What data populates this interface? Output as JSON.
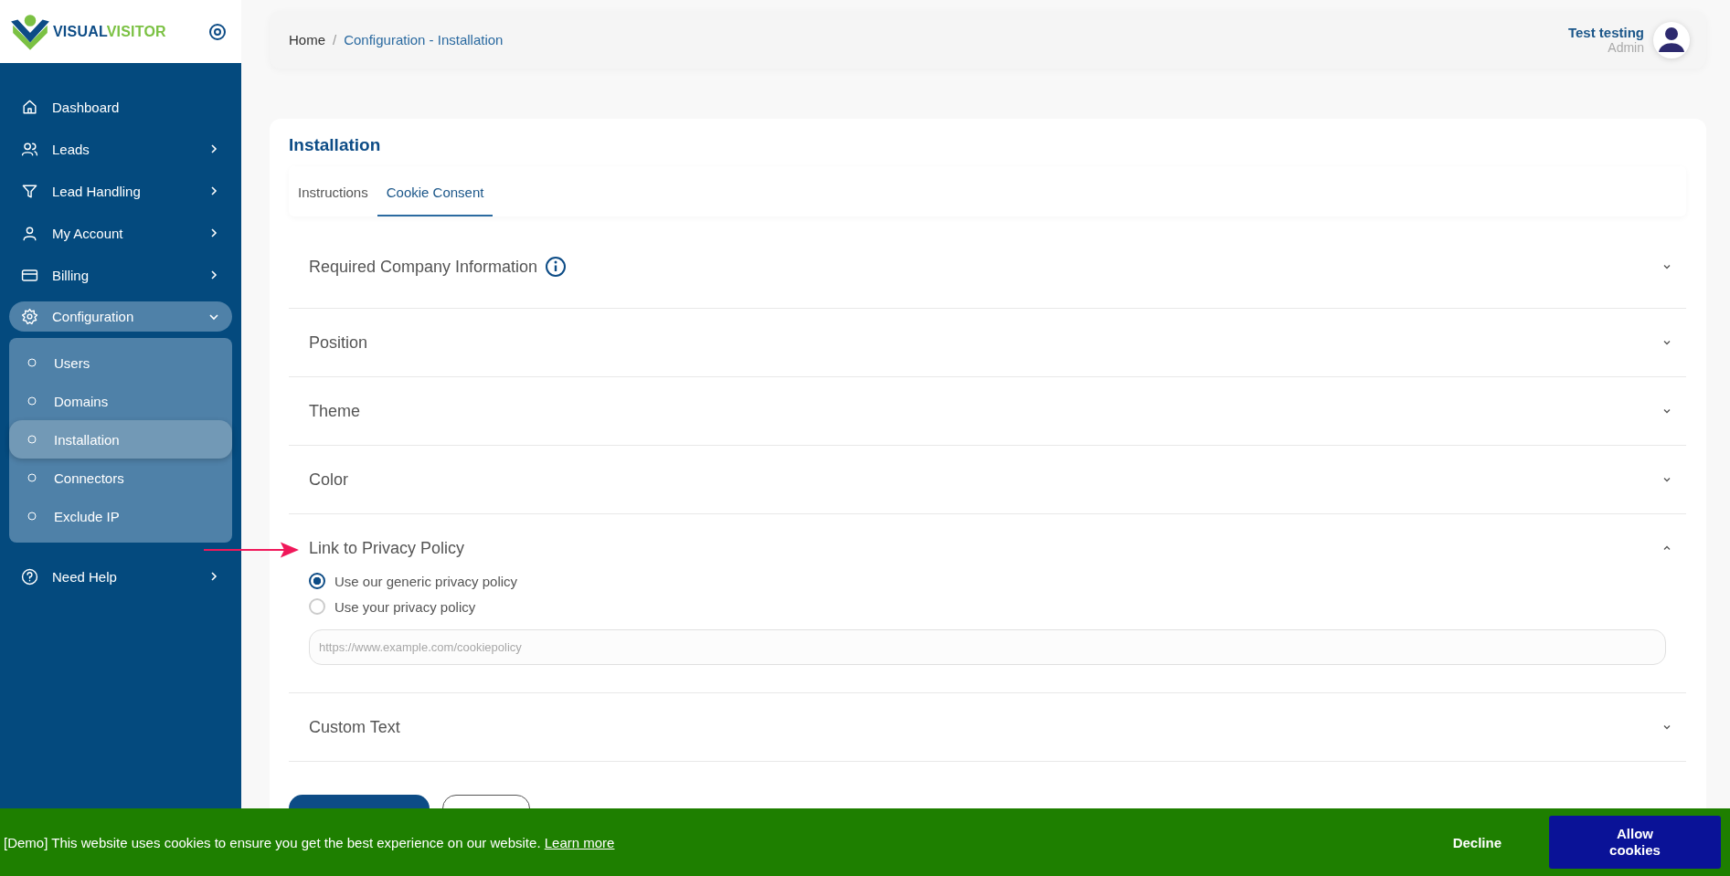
{
  "sidebar": {
    "logo": {
      "part_1": "VISUAL",
      "part_2": "VISITOR"
    },
    "items": [
      {
        "label": "Dashboard",
        "kind": "link"
      },
      {
        "label": "Leads",
        "kind": "group",
        "expanded": false
      },
      {
        "label": "Lead Handling",
        "kind": "group",
        "expanded": false
      },
      {
        "label": "My Account",
        "kind": "group",
        "expanded": false
      },
      {
        "label": "Billing",
        "kind": "group",
        "expanded": false
      },
      {
        "label": "Configuration",
        "kind": "group",
        "expanded": true,
        "children": [
          {
            "label": "Users",
            "selected": false
          },
          {
            "label": "Domains",
            "selected": false
          },
          {
            "label": "Installation",
            "selected": true
          },
          {
            "label": "Connectors",
            "selected": false
          },
          {
            "label": "Exclude IP",
            "selected": false
          }
        ]
      },
      {
        "label": "Need Help",
        "kind": "group",
        "expanded": false
      }
    ]
  },
  "breadcrumb": {
    "separator": "/",
    "items": [
      "Home",
      "Configuration - Installation"
    ]
  },
  "user": {
    "name": "Test testing",
    "role": "Admin"
  },
  "card": {
    "title": "Installation",
    "tabs": [
      {
        "label": "Instructions",
        "selected": false
      },
      {
        "label": "Cookie Consent",
        "selected": true
      }
    ],
    "sections": [
      {
        "title": "Required Company Information",
        "info": true,
        "expanded": false,
        "annotated": false
      },
      {
        "title": "Position",
        "info": false,
        "expanded": false,
        "annotated": false
      },
      {
        "title": "Theme",
        "info": false,
        "expanded": false,
        "annotated": false
      },
      {
        "title": "Color",
        "info": false,
        "expanded": false,
        "annotated": false
      },
      {
        "title": "Link to Privacy Policy",
        "info": false,
        "expanded": true,
        "annotated": true,
        "options": [
          {
            "label": "Use our generic privacy policy",
            "selected": true
          },
          {
            "label": "Use your privacy policy",
            "selected": false
          }
        ],
        "url_field": {
          "placeholder": "https://www.example.com/cookiepolicy"
        }
      },
      {
        "title": "Custom Text",
        "info": false,
        "expanded": false,
        "annotated": false
      }
    ]
  },
  "cookie_bar": {
    "message": "[Demo] This website uses cookies to ensure you get the best experience on our website.",
    "link": "Learn more",
    "decline": "Decline",
    "allow": "Allow cookies"
  }
}
